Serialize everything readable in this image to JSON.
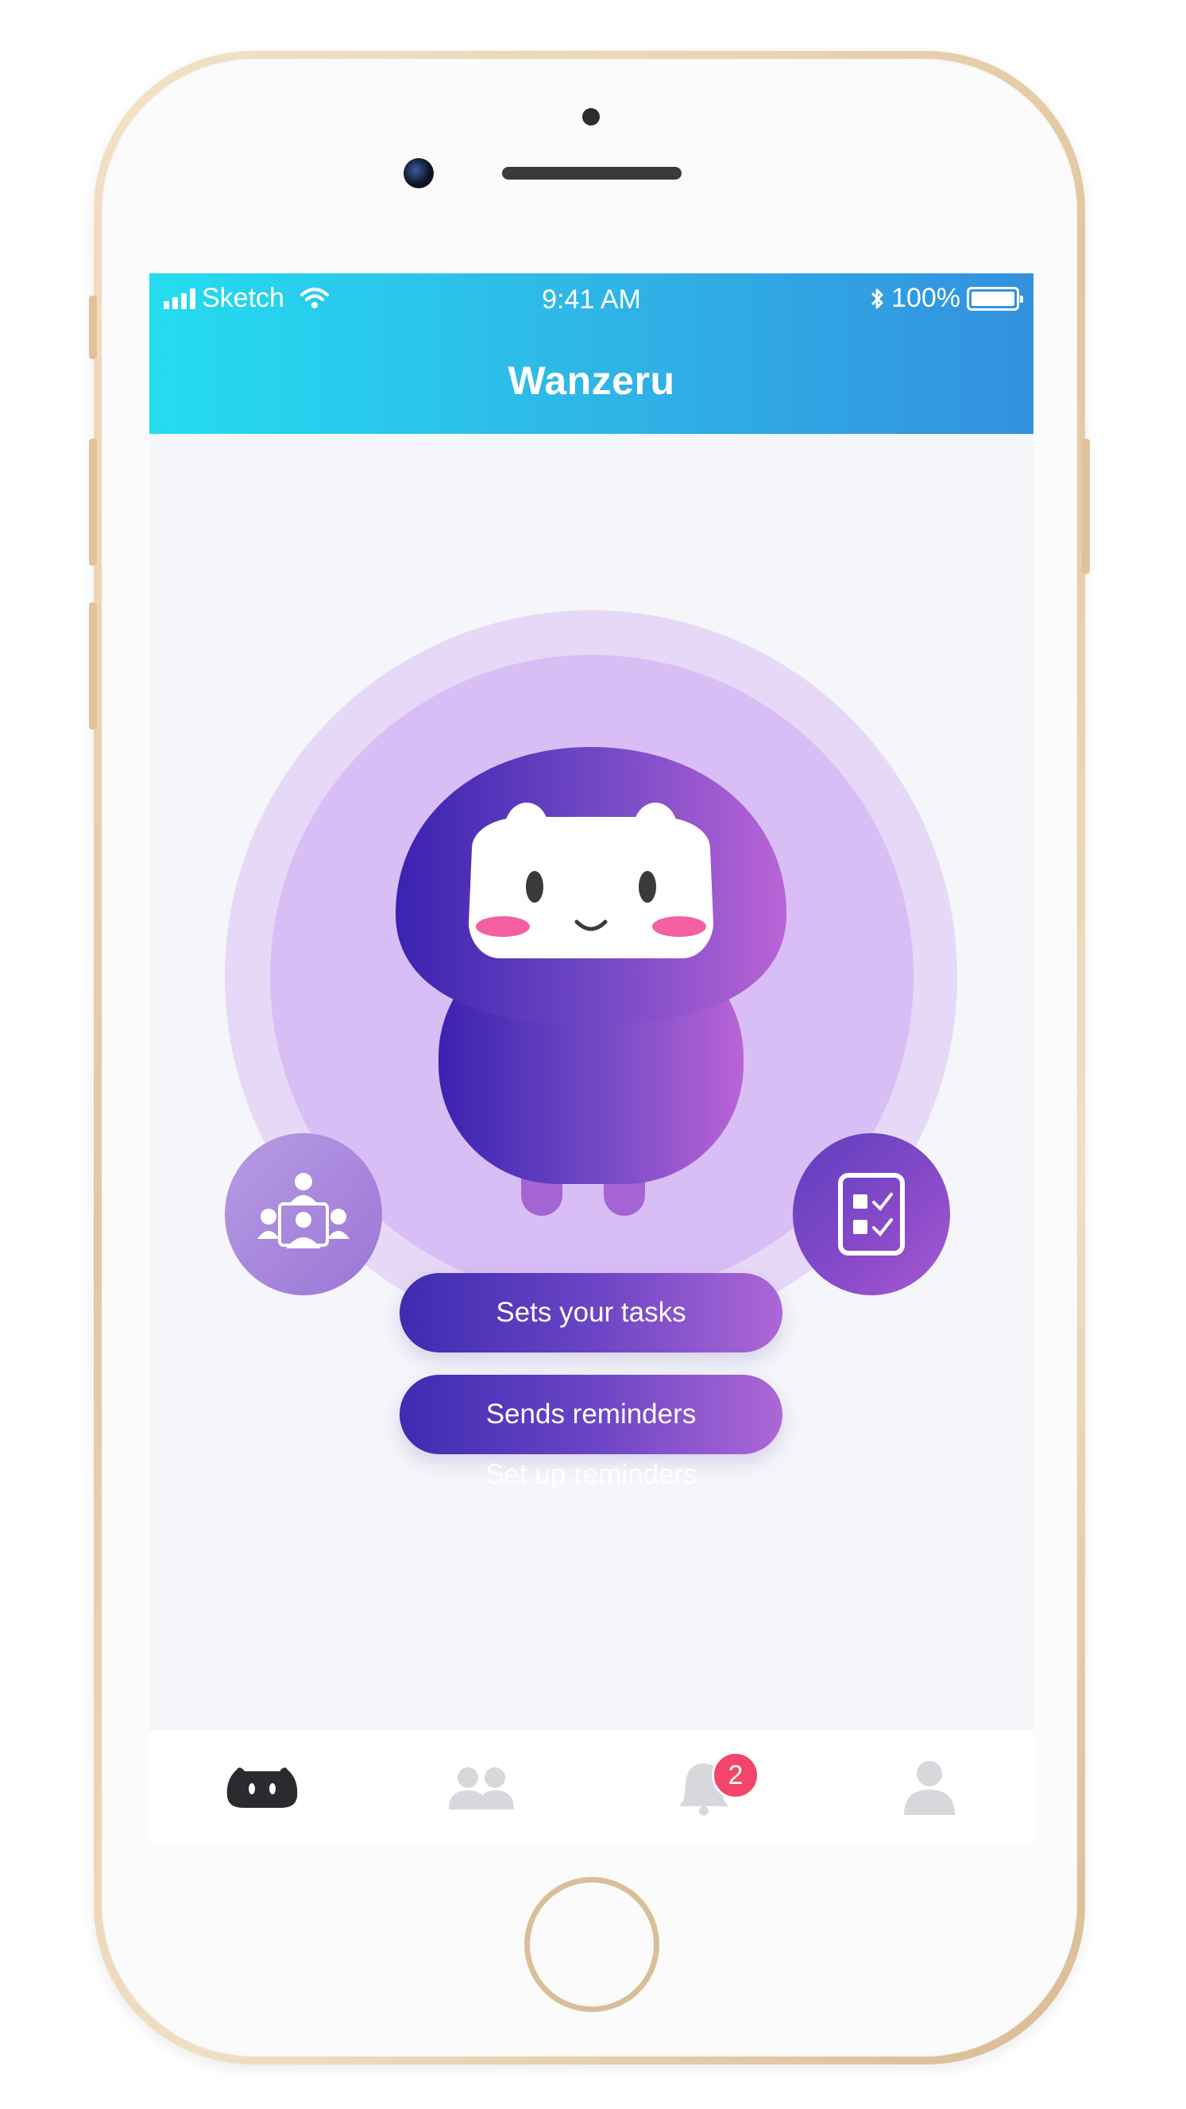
{
  "status_bar": {
    "carrier": "Sketch",
    "time": "9:41 AM",
    "battery": "100%"
  },
  "header": {
    "title": "Wanzeru"
  },
  "hero": {
    "left_feature_icon": "group-meeting-icon",
    "right_feature_icon": "task-checklist-icon",
    "mascot_icon": "wanzeru-mascot-icon"
  },
  "buttons": {
    "sets_tasks": "Sets your tasks",
    "sends_reminders": "Sends reminders"
  },
  "link": {
    "setup": "Set up reminders"
  },
  "tab_bar": {
    "items": [
      {
        "icon": "mascot-icon",
        "active": true
      },
      {
        "icon": "people-icon",
        "active": false
      },
      {
        "icon": "bell-icon",
        "active": false,
        "badge": "2"
      },
      {
        "icon": "profile-icon",
        "active": false
      }
    ]
  },
  "colors": {
    "header_start": "#25dcf0",
    "header_end": "#3291df",
    "button_start": "#3d2bb1",
    "button_end": "#ad67d6",
    "badge": "#f24569",
    "halo_outer": "#e7d8f7",
    "halo_inner": "#d9bdf5"
  }
}
